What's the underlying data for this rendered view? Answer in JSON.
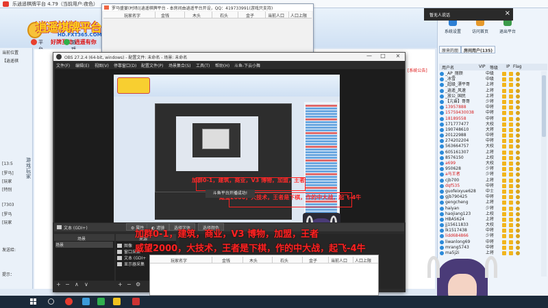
{
  "platform": {
    "title": "乐逍遥棋牌平台 4.79（当前用户:夜色）",
    "logo_main": "逍遥棋牌平台",
    "logo_url": "HD.FXT365.COM",
    "logo_slogan": "好牌互动 逍遥有你",
    "tabs": [
      "平台主页",
      "游戏房间"
    ],
    "left_lines": [
      "当前位置",
      "【逍遥棋",
      "[13:5",
      "[罗马]",
      "[玩家",
      "[特别",
      "[7303",
      "[罗马",
      "[玩家"
    ],
    "left_side_label": "游戏玩家",
    "left_bottom_1": "发送给:",
    "left_bottom_2": "提示：",
    "toolbar": [
      "系统设置",
      "访问首页",
      "退出平台"
    ],
    "system_notice": "[系统公告]",
    "notification_title": "暂无人说话"
  },
  "user_panel": {
    "tabs": [
      "原来的朋",
      "房间用户(135)"
    ],
    "columns": [
      "用户名",
      "VIP",
      "等级",
      "IP",
      "Flag"
    ],
    "users": [
      {
        "name": "_AP_丽颜",
        "level": "中级"
      },
      {
        "name": "_冰雪",
        "level": "中级"
      },
      {
        "name": "_超级_漂平哥",
        "level": "上将"
      },
      {
        "name": "_逍遥_风速",
        "level": "上将"
      },
      {
        "name": "_放公_国民",
        "level": "上将"
      },
      {
        "name": "【亢奋】哥哥",
        "level": "少将"
      },
      {
        "name": "13957888",
        "level": "中将"
      },
      {
        "name": "15759430038",
        "level": "中将"
      },
      {
        "name": "18189558",
        "level": "中将"
      },
      {
        "name": "171777477",
        "level": "大校"
      },
      {
        "name": "190748610",
        "level": "大将"
      },
      {
        "name": "20122988",
        "level": "中将"
      },
      {
        "name": "274202204",
        "level": "中将"
      },
      {
        "name": "563664757",
        "level": "大校"
      },
      {
        "name": "605161307",
        "level": "上将"
      },
      {
        "name": "8576150",
        "level": "上校"
      },
      {
        "name": "a699",
        "level": "大校"
      },
      {
        "name": "950628",
        "level": "少将"
      },
      {
        "name": "a马王者",
        "level": "少将"
      },
      {
        "name": "cjb700",
        "level": "上将"
      },
      {
        "name": "dqf535",
        "level": "中将"
      },
      {
        "name": "guofeixyue628",
        "level": "中士"
      },
      {
        "name": "gjb790425",
        "level": "中将"
      },
      {
        "name": "gengcheng",
        "level": "上将"
      },
      {
        "name": "haiyan",
        "level": "少将"
      },
      {
        "name": "haojiang123",
        "level": "上校"
      },
      {
        "name": "HBA5624",
        "level": "上将"
      },
      {
        "name": "jj15611833",
        "level": "大校"
      },
      {
        "name": "lk1517438",
        "level": "中将"
      },
      {
        "name": "lidd684866",
        "level": "少将"
      },
      {
        "name": "liwanlong69",
        "level": "中将"
      },
      {
        "name": "mrang5743",
        "level": "中将"
      },
      {
        "name": "ma5j2i",
        "level": "上将"
      }
    ]
  },
  "room_window": {
    "title": "罗马盛宴(村场)|逍遥棋牌平台 - 本房间由逍遥平台开设，QQ：419733991(游戏只支持)",
    "columns": [
      "玩家名字",
      "金钱",
      "木头",
      "石头",
      "金子",
      "当前人口",
      "人口上限"
    ]
  },
  "obs": {
    "title": "OBS 27.2.4 (64-bit, windows) - 配置文件: 未命名 - 场景: 未命名",
    "menu": [
      "文件(F)",
      "编辑(E)",
      "视图(V)",
      "停靠窗口(D)",
      "配置文件(P)",
      "场景集合(S)",
      "工具(T)",
      "帮助(H)",
      "斗鱼-下云小舞"
    ],
    "source_label": "文本 (GDI+)",
    "buttons": [
      "属性",
      "滤镜",
      "选择字体",
      "选择颜色"
    ],
    "scenes_header": "场景",
    "scenes": [
      "场景"
    ],
    "sources_header": "来源",
    "sources": [
      "图像",
      "窗口采集",
      "文本 (GDI+",
      "显示器采集"
    ],
    "success_toast": "斗鱼平台开播成功!",
    "controls": [
      "+",
      "−",
      "∧",
      "∨",
      "⚙"
    ]
  },
  "overlay": {
    "line1": "加群0-1，建筑，商业，V3 博物，加盟，王者",
    "line2": "威望2000，大技术，王者是下棋，作的中大战，起飞-4牛"
  }
}
